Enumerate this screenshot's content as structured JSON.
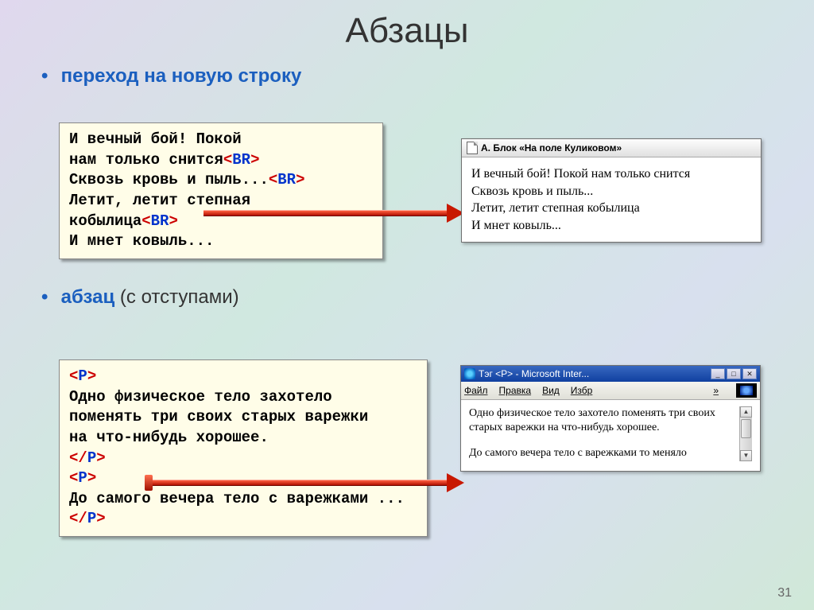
{
  "title": "Абзацы",
  "bullets": {
    "b1": "переход на новую строку",
    "b2_bold": "абзац",
    "b2_plain": " (с отступами)"
  },
  "code1": {
    "l1": "И вечный бой! Покой",
    "l2a": "нам только снится",
    "l3a": "Сквозь кровь и пыль...",
    "l4": "Летит, летит степная",
    "l5a": "кобылица",
    "l6": "И мнет ковыль...",
    "br_lt": "<",
    "br_tag": "BR",
    "br_gt": ">"
  },
  "win1": {
    "title": "А. Блок «На поле Куликовом»",
    "line1": "И вечный бой! Покой нам только снится",
    "line2": "Сквозь кровь и пыль...",
    "line3": "Летит, летит степная кобылица",
    "line4": "И мнет ковыль..."
  },
  "code2": {
    "p_open_lt": "<",
    "p_tag": "P",
    "p_open_gt": ">",
    "p_close_lt": "</",
    "l1": "Одно физическое тело захотело",
    "l2": "поменять три своих старых варежки",
    "l3": "на что-нибудь хорошее.",
    "l5": "До самого вечера тело с варежками ..."
  },
  "win2": {
    "title": "Тэг <P> - Microsoft Inter...",
    "menu": {
      "m1": "Файл",
      "m2": "Правка",
      "m3": "Вид",
      "m4": "Избр",
      "chev": "»"
    },
    "p1": "Одно физическое тело захотело поменять три своих старых варежки на что-нибудь хорошее.",
    "p2": "До самого вечера тело с варежками то меняло"
  },
  "page_num": "31"
}
